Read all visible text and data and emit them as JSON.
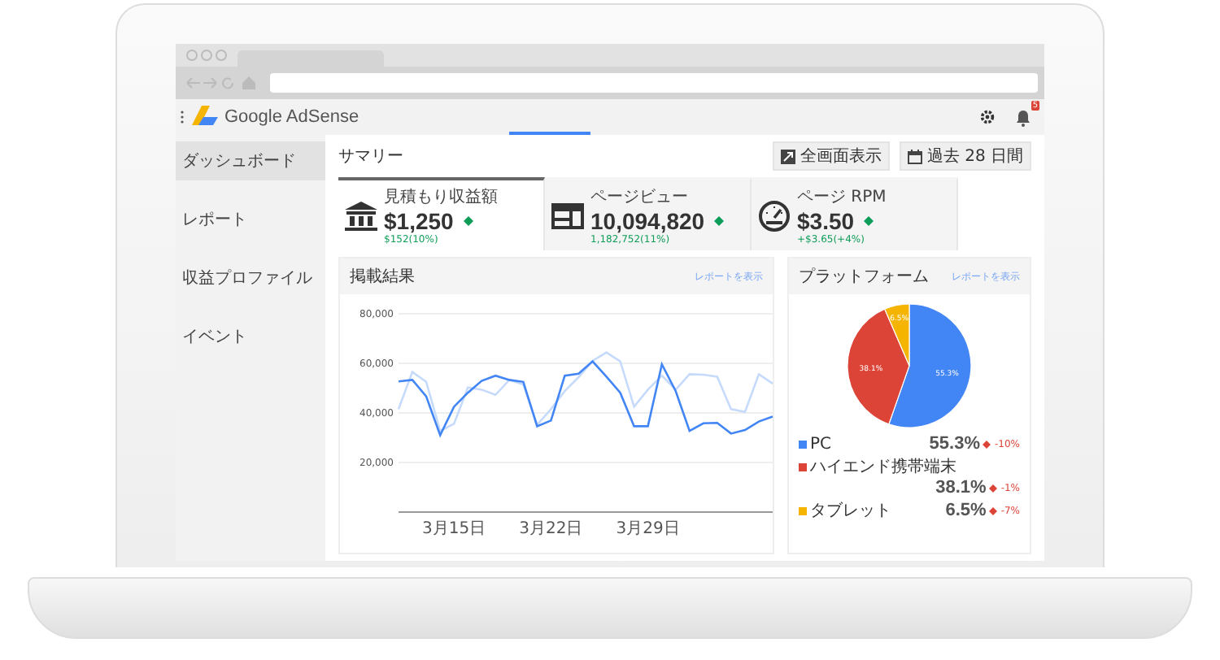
{
  "app": {
    "title": "Google AdSense",
    "notification_count": "5"
  },
  "sidebar": {
    "items": [
      {
        "label": "ダッシュボード",
        "selected": true
      },
      {
        "label": "レポート",
        "selected": false
      },
      {
        "label": "収益プロファイル",
        "selected": false
      },
      {
        "label": "イベント",
        "selected": false
      }
    ]
  },
  "summary": {
    "title": "サマリー",
    "buttons": [
      {
        "label": "全画面表示",
        "kind": "fullscreen"
      },
      {
        "label": "過去 28 日間",
        "kind": "calendar"
      }
    ]
  },
  "cards": [
    {
      "kind": "bank",
      "label": "見積もり収益額",
      "value": "$1,250",
      "change": "$152(10%)",
      "selected": true
    },
    {
      "kind": "window",
      "label": "ページビュー",
      "value": "10,094,820",
      "change": "1,182,752(11%)",
      "selected": false
    },
    {
      "kind": "gauge",
      "label": "ページ RPM",
      "value": "$3.50",
      "change": "+$3.65(+4%)",
      "selected": false
    }
  ],
  "performance_panel": {
    "title": "掲載結果",
    "link": "レポートを表示",
    "chart_data": {
      "type": "line",
      "categories": [
        null,
        null,
        null,
        null,
        "3月15日",
        null,
        null,
        null,
        null,
        null,
        null,
        "3月22日",
        null,
        null,
        null,
        null,
        null,
        null,
        "3月29日",
        null,
        null,
        null,
        null,
        null,
        null,
        null,
        null,
        null
      ],
      "series": [
        {
          "color": "#c6dafc",
          "values": [
            41500,
            56500,
            52500,
            32700,
            35600,
            50200,
            49400,
            47300,
            53300,
            51500,
            35200,
            41500,
            48800,
            54400,
            61000,
            64400,
            60800,
            42500,
            49400,
            55000,
            49400,
            55600,
            55400,
            54600,
            41500,
            40400,
            55600,
            51900
          ]
        },
        {
          "color": "#4285f4",
          "values": [
            52700,
            53300,
            46700,
            31000,
            42500,
            48100,
            52900,
            55000,
            53300,
            52500,
            34600,
            36900,
            55000,
            55800,
            60800,
            54600,
            48100,
            34600,
            34600,
            59600,
            48800,
            32700,
            35800,
            36000,
            31700,
            33100,
            36500,
            38500
          ]
        }
      ],
      "grid": true,
      "ylim": [
        0,
        80000
      ],
      "yticks": [
        {
          "value": 20000,
          "label": "20,000"
        },
        {
          "value": 40000,
          "label": "40,000"
        },
        {
          "value": 60000,
          "label": "60,000"
        },
        {
          "value": 80000,
          "label": "80,000"
        }
      ]
    }
  },
  "platform_panel": {
    "title": "プラットフォーム",
    "link": "レポートを表示",
    "chart_data": {
      "type": "pie",
      "categories": [
        "PC",
        "ハイエンド携帯端末",
        "タブレット"
      ],
      "values": [
        55.3,
        38.1,
        6.5
      ],
      "value_labels": [
        "55.3%",
        "38.1%",
        "6.5%"
      ]
    },
    "legend": [
      {
        "color": "#4285f4",
        "share": "55.3%",
        "change": "-10%"
      },
      {
        "color": "#db4437",
        "share": "38.1%",
        "change": "-1%"
      },
      {
        "color": "#f4b400",
        "share": "6.5%",
        "change": "-7%"
      }
    ]
  }
}
